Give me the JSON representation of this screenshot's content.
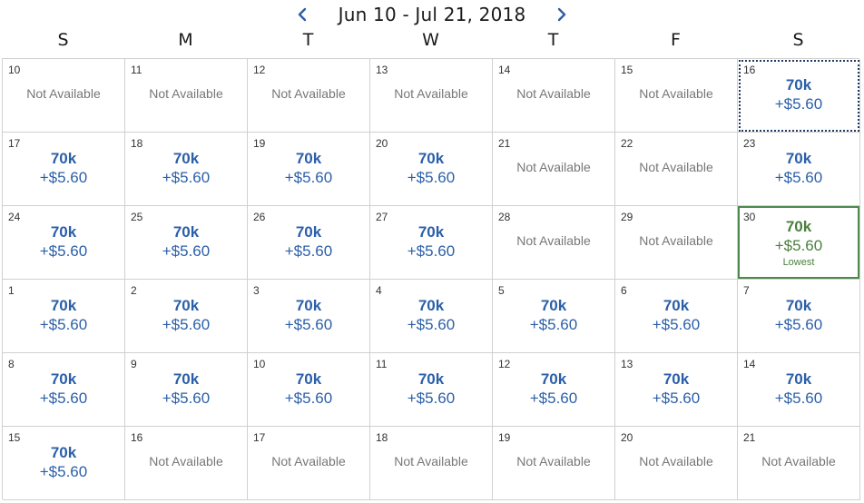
{
  "header": {
    "range": "Jun 10 - Jul 21, 2018",
    "prev_icon": "chevron-left-icon",
    "next_icon": "chevron-right-icon",
    "accent_color": "#2b5fa8"
  },
  "weekdays": [
    "S",
    "M",
    "T",
    "W",
    "T",
    "F",
    "S"
  ],
  "labels": {
    "not_available": "Not Available",
    "lowest": "Lowest"
  },
  "colors": {
    "price": "#2b5fa8",
    "lowest": "#4a7f3d",
    "not_available": "#777777"
  },
  "weeks": [
    [
      {
        "day": "10",
        "available": false
      },
      {
        "day": "11",
        "available": false
      },
      {
        "day": "12",
        "available": false
      },
      {
        "day": "13",
        "available": false
      },
      {
        "day": "14",
        "available": false
      },
      {
        "day": "15",
        "available": false
      },
      {
        "day": "16",
        "available": true,
        "miles": "70k",
        "fee": "+$5.60",
        "selected": true
      }
    ],
    [
      {
        "day": "17",
        "available": true,
        "miles": "70k",
        "fee": "+$5.60"
      },
      {
        "day": "18",
        "available": true,
        "miles": "70k",
        "fee": "+$5.60"
      },
      {
        "day": "19",
        "available": true,
        "miles": "70k",
        "fee": "+$5.60"
      },
      {
        "day": "20",
        "available": true,
        "miles": "70k",
        "fee": "+$5.60"
      },
      {
        "day": "21",
        "available": false
      },
      {
        "day": "22",
        "available": false
      },
      {
        "day": "23",
        "available": true,
        "miles": "70k",
        "fee": "+$5.60"
      }
    ],
    [
      {
        "day": "24",
        "available": true,
        "miles": "70k",
        "fee": "+$5.60"
      },
      {
        "day": "25",
        "available": true,
        "miles": "70k",
        "fee": "+$5.60"
      },
      {
        "day": "26",
        "available": true,
        "miles": "70k",
        "fee": "+$5.60"
      },
      {
        "day": "27",
        "available": true,
        "miles": "70k",
        "fee": "+$5.60"
      },
      {
        "day": "28",
        "available": false
      },
      {
        "day": "29",
        "available": false
      },
      {
        "day": "30",
        "available": true,
        "miles": "70k",
        "fee": "+$5.60",
        "lowest": true
      }
    ],
    [
      {
        "day": "1",
        "available": true,
        "miles": "70k",
        "fee": "+$5.60"
      },
      {
        "day": "2",
        "available": true,
        "miles": "70k",
        "fee": "+$5.60"
      },
      {
        "day": "3",
        "available": true,
        "miles": "70k",
        "fee": "+$5.60"
      },
      {
        "day": "4",
        "available": true,
        "miles": "70k",
        "fee": "+$5.60"
      },
      {
        "day": "5",
        "available": true,
        "miles": "70k",
        "fee": "+$5.60"
      },
      {
        "day": "6",
        "available": true,
        "miles": "70k",
        "fee": "+$5.60"
      },
      {
        "day": "7",
        "available": true,
        "miles": "70k",
        "fee": "+$5.60"
      }
    ],
    [
      {
        "day": "8",
        "available": true,
        "miles": "70k",
        "fee": "+$5.60"
      },
      {
        "day": "9",
        "available": true,
        "miles": "70k",
        "fee": "+$5.60"
      },
      {
        "day": "10",
        "available": true,
        "miles": "70k",
        "fee": "+$5.60"
      },
      {
        "day": "11",
        "available": true,
        "miles": "70k",
        "fee": "+$5.60"
      },
      {
        "day": "12",
        "available": true,
        "miles": "70k",
        "fee": "+$5.60"
      },
      {
        "day": "13",
        "available": true,
        "miles": "70k",
        "fee": "+$5.60"
      },
      {
        "day": "14",
        "available": true,
        "miles": "70k",
        "fee": "+$5.60"
      }
    ],
    [
      {
        "day": "15",
        "available": true,
        "miles": "70k",
        "fee": "+$5.60"
      },
      {
        "day": "16",
        "available": false
      },
      {
        "day": "17",
        "available": false
      },
      {
        "day": "18",
        "available": false
      },
      {
        "day": "19",
        "available": false
      },
      {
        "day": "20",
        "available": false
      },
      {
        "day": "21",
        "available": false
      }
    ]
  ]
}
